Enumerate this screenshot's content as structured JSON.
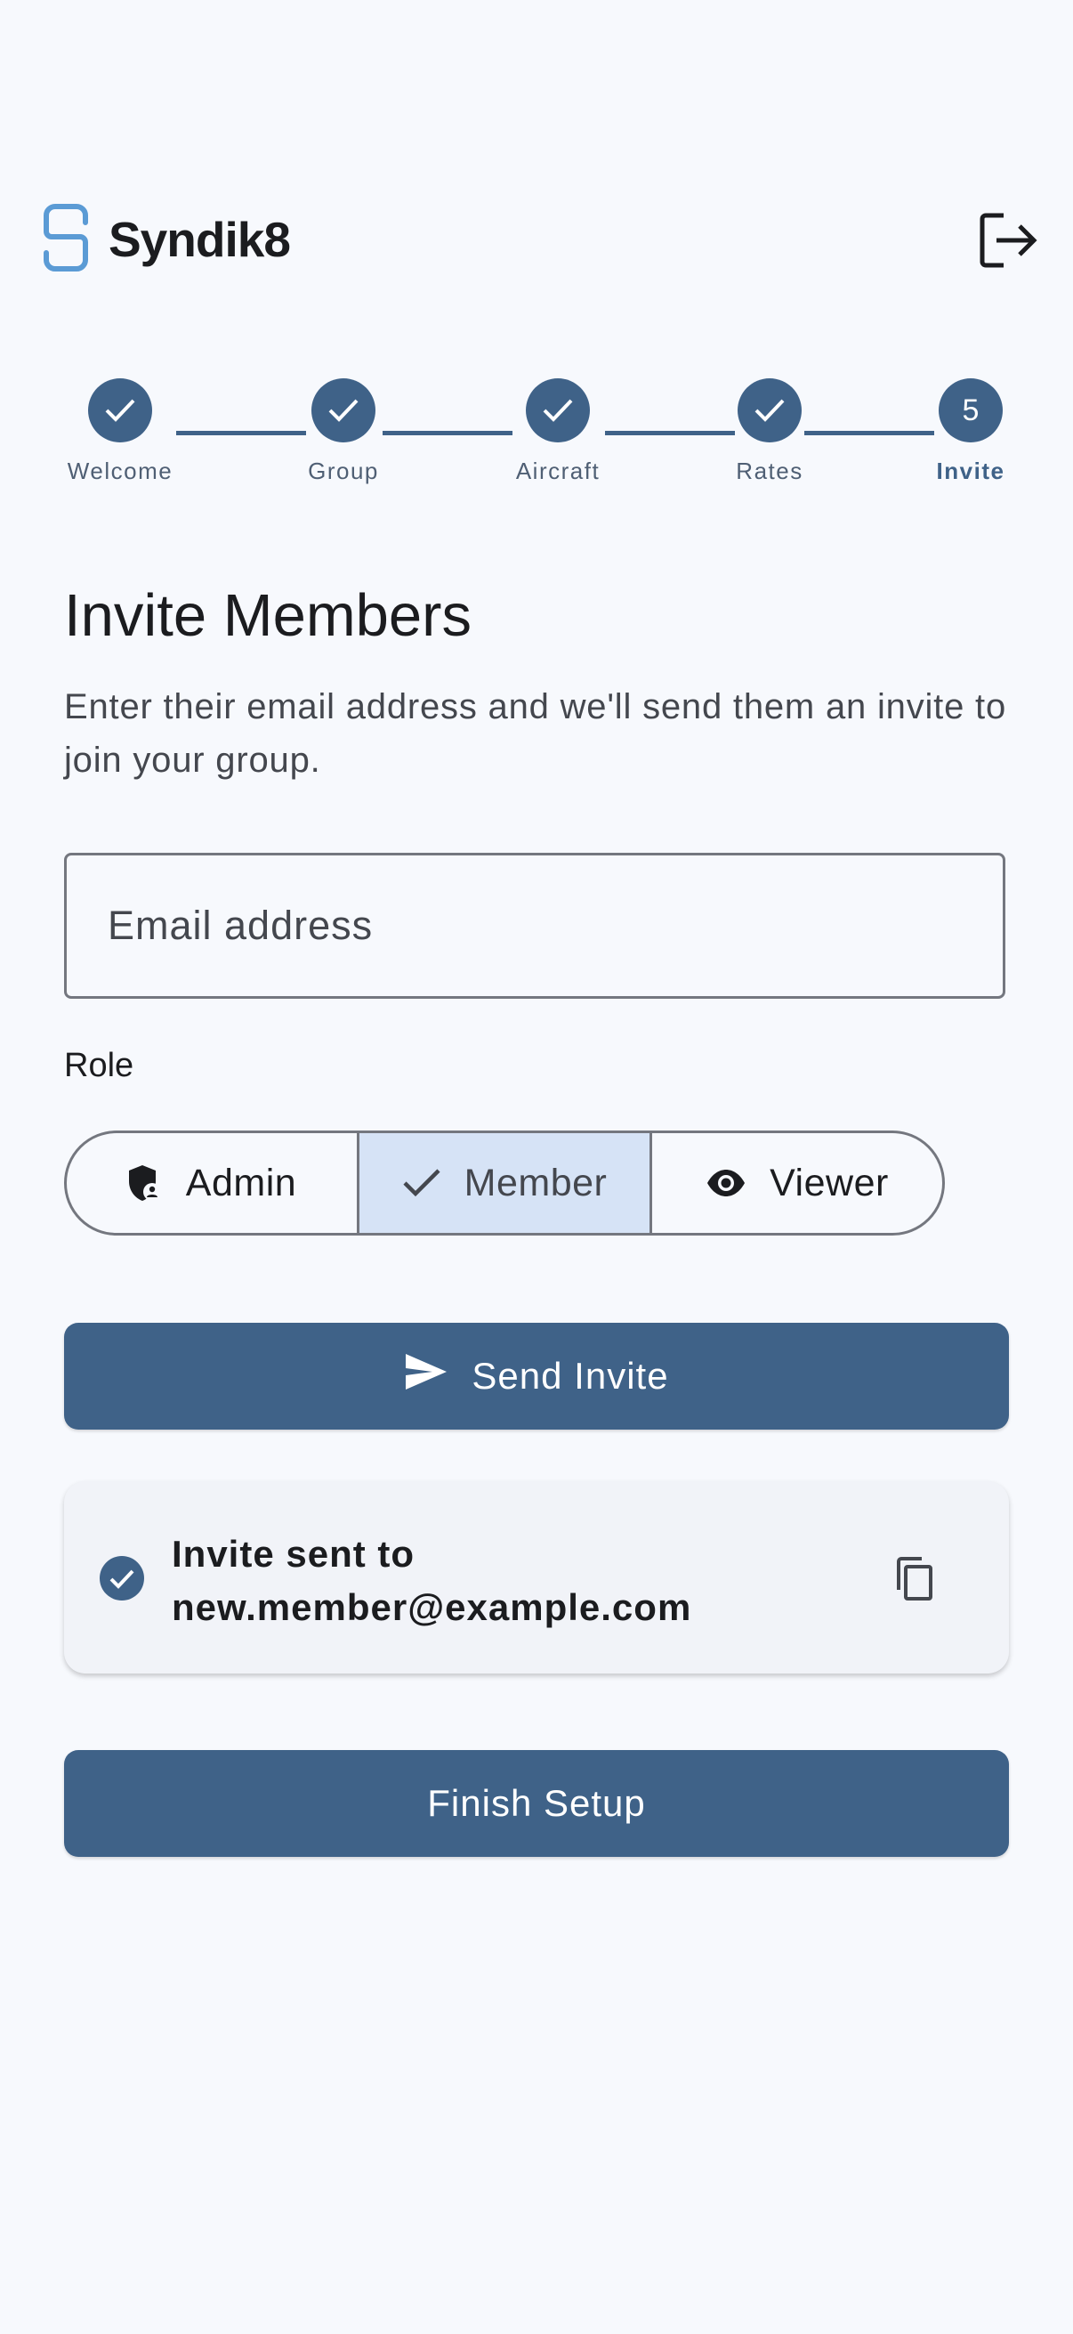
{
  "header": {
    "brand": "Syndik8",
    "logo_icon": "syndik8-logo-icon",
    "logout_icon": "logout-icon"
  },
  "stepper": {
    "steps": [
      {
        "label": "Welcome",
        "state": "complete"
      },
      {
        "label": "Group",
        "state": "complete"
      },
      {
        "label": "Aircraft",
        "state": "complete"
      },
      {
        "label": "Rates",
        "state": "complete"
      },
      {
        "label": "Invite",
        "state": "active",
        "number": "5"
      }
    ]
  },
  "main": {
    "title": "Invite Members",
    "subtitle": "Enter their email address and we'll send them an invite to join your group.",
    "email_placeholder": "Email address",
    "role_label": "Role",
    "roles": [
      {
        "label": "Admin",
        "icon": "admin-shield-icon",
        "selected": false
      },
      {
        "label": "Member",
        "icon": "check-icon",
        "selected": true
      },
      {
        "label": "Viewer",
        "icon": "eye-icon",
        "selected": false
      }
    ],
    "send_label": "Send Invite",
    "confirmation": {
      "line1": "Invite sent to",
      "line2": "new.member@example.com"
    },
    "finish_label": "Finish Setup"
  },
  "colors": {
    "primary": "#3f6288",
    "background": "#f7f9fd",
    "selected_segment": "#d6e3f6",
    "logo_blue": "#5b9bd5"
  }
}
